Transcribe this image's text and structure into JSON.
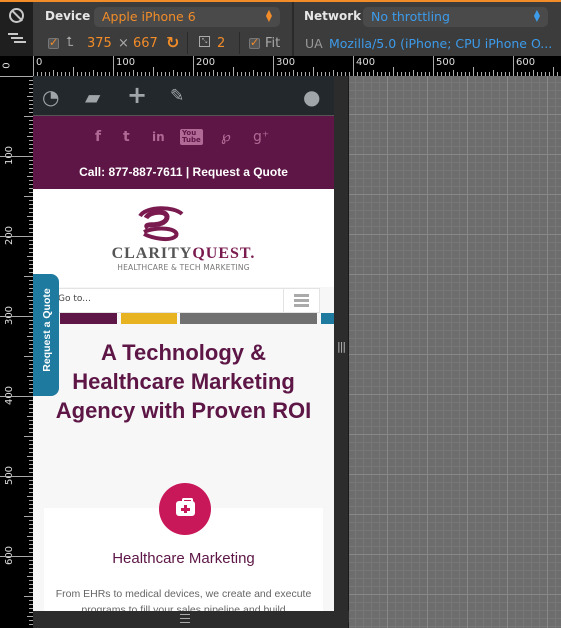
{
  "toolbar": {
    "device_label": "Device",
    "device_value": "Apple iPhone 6",
    "network_label": "Network",
    "network_value": "No throttling",
    "width": "375",
    "times": "×",
    "height": "667",
    "pixel_ratio": "2",
    "fit_label": "Fit",
    "ua_label": "UA",
    "ua_value": "Mozilla/5.0 (iPhone; CPU iPhone O...",
    "accent_color": "#f28c28",
    "link_color": "#3d9bea"
  },
  "rulers": {
    "horizontal": [
      "0",
      "100",
      "200",
      "300",
      "400",
      "500",
      "600"
    ],
    "vertical": [
      "0",
      "100",
      "200",
      "300",
      "400",
      "500",
      "600"
    ]
  },
  "page": {
    "admin_bar_icons": [
      "dashboard-icon",
      "comment-icon",
      "plus-icon",
      "pencil-icon",
      "user-icon"
    ],
    "social_icons": [
      {
        "name": "facebook-icon",
        "glyph": "f"
      },
      {
        "name": "twitter-icon",
        "glyph": "t"
      },
      {
        "name": "linkedin-icon",
        "glyph": "in"
      },
      {
        "name": "youtube-icon",
        "glyph": "You Tube"
      },
      {
        "name": "pinterest-icon",
        "glyph": "P"
      },
      {
        "name": "google-plus-icon",
        "glyph": "g+"
      }
    ],
    "call_text": "Call: 877-887-7611 | Request a Quote",
    "logo_text_a": "CLARITY",
    "logo_text_b": "QUEST",
    "logo_tagline": "HEALTHCARE & TECH MARKETING",
    "nav_placeholder": "Go to...",
    "request_tab": "Request a Quote",
    "headline": "A Technology & Healthcare Marketing Agency with Proven ROI",
    "card_title": "Healthcare Marketing",
    "card_body": "From EHRs to medical devices, we create and execute programs to fill your sales pipeline and build",
    "brand_purple": "#5d1646",
    "brand_pink": "#c8185a",
    "brand_blue": "#1e7a9e",
    "stripe_colors": [
      "#5d1646",
      "#e8b321",
      "#707070",
      "#1e7a9e"
    ]
  }
}
